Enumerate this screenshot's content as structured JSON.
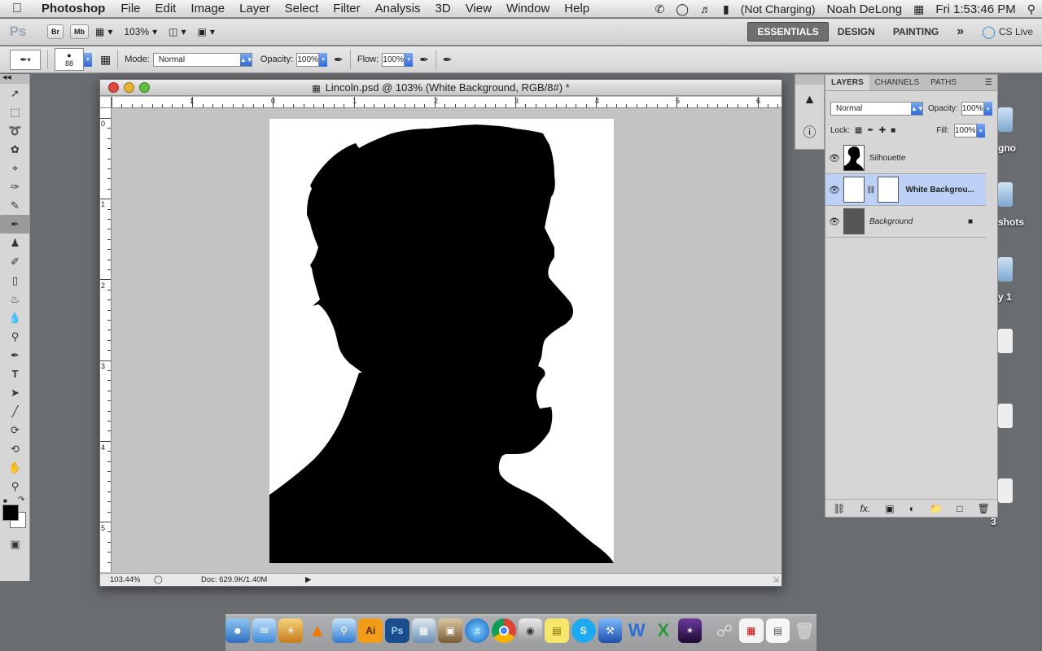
{
  "menubar": {
    "app_name": "Photoshop",
    "items": [
      "File",
      "Edit",
      "Image",
      "Layer",
      "Select",
      "Filter",
      "Analysis",
      "3D",
      "View",
      "Window",
      "Help"
    ],
    "battery_text": "(Not Charging)",
    "user": "Noah DeLong",
    "clock": "Fri 1:53:46 PM"
  },
  "appbar": {
    "logo": "Ps",
    "bridge_label": "Br",
    "minibridge_label": "Mb",
    "zoom": "103%",
    "workspaces": [
      "ESSENTIALS",
      "DESIGN",
      "PAINTING"
    ],
    "more_label": "»",
    "cslive_label": "CS Live"
  },
  "options": {
    "brush_size": "88",
    "mode_label": "Mode:",
    "mode_value": "Normal",
    "opacity_label": "Opacity:",
    "opacity_value": "100%",
    "flow_label": "Flow:",
    "flow_value": "100%"
  },
  "document": {
    "title": "Lincoln.psd @ 103% (White Background, RGB/8#) *",
    "zoom_status": "103.44%",
    "doc_info": "Doc: 629.9K/1.40M",
    "ruler_top": [
      "1",
      "0",
      "1",
      "2",
      "3",
      "4",
      "5",
      "6"
    ],
    "ruler_left": [
      "0",
      "1",
      "2",
      "3",
      "4",
      "5"
    ]
  },
  "layers_panel": {
    "tabs": [
      "LAYERS",
      "CHANNELS",
      "PATHS"
    ],
    "blend_mode": "Normal",
    "opacity_label": "Opacity:",
    "opacity_value": "100%",
    "lock_label": "Lock:",
    "fill_label": "Fill:",
    "fill_value": "100%",
    "layers": [
      {
        "name": "Silhouette"
      },
      {
        "name": "White Backgrou..."
      },
      {
        "name": "Background"
      }
    ],
    "footer_fx": "fx."
  },
  "desktop": {
    "labels": [
      "gno",
      "shots",
      "y 1",
      "3"
    ]
  },
  "dock": {
    "apps": [
      "Finder",
      "Mail",
      "iPhoto",
      "VLC",
      "Safari",
      "Illustrator",
      "Photoshop",
      "Preview",
      "iTunes",
      "Chrome",
      "Photo Booth",
      "Stickies",
      "Skype",
      "Xcode",
      "Word",
      "Excel",
      "Aperture",
      "Disk Utility",
      "Calendar",
      "TextEdit",
      "Trash"
    ]
  },
  "colors": {
    "selection_blue": "#bcd1f5",
    "accent_blue": "#2f6ad8",
    "canvas_bg": "#c3c3c3"
  }
}
